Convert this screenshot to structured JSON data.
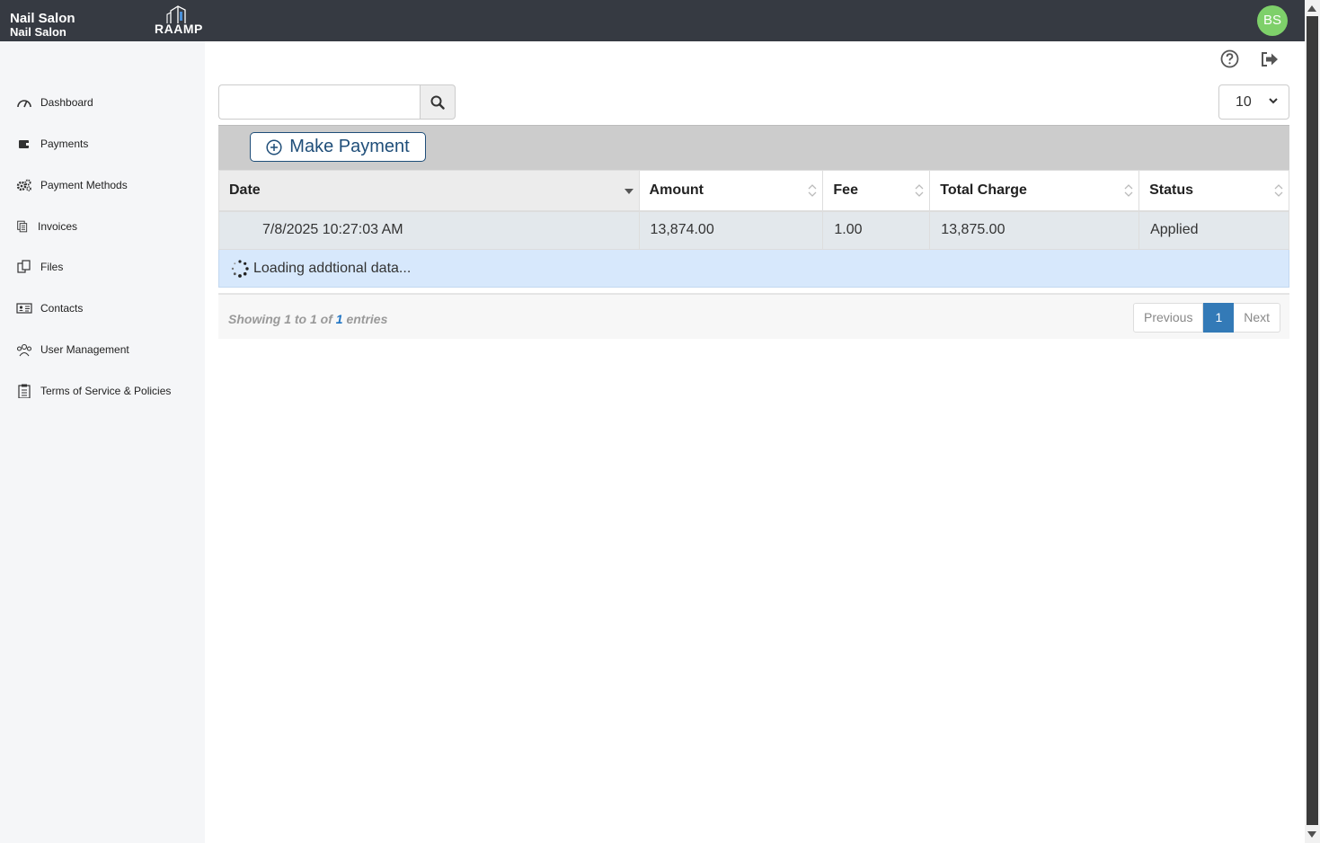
{
  "header": {
    "brand_line1": "Nail Salon",
    "brand_line2": "Nail Salon",
    "logo_text": "RAAMP",
    "avatar_initials": "BS",
    "avatar_color": "#7ed06a"
  },
  "sidebar": {
    "items": [
      {
        "label": "Dashboard",
        "icon": "speedometer-icon"
      },
      {
        "label": "Payments",
        "icon": "wallet-icon"
      },
      {
        "label": "Payment Methods",
        "icon": "gears-icon"
      },
      {
        "label": "Invoices",
        "icon": "invoice-icon"
      },
      {
        "label": "Files",
        "icon": "files-icon"
      },
      {
        "label": "Contacts",
        "icon": "contact-card-icon"
      },
      {
        "label": "User Management",
        "icon": "users-icon"
      },
      {
        "label": "Terms of Service & Policies",
        "icon": "clipboard-icon"
      }
    ]
  },
  "toolbar": {
    "search_value": "",
    "page_size": "10",
    "make_payment_label": "Make Payment"
  },
  "table": {
    "columns": [
      "Date",
      "Amount",
      "Fee",
      "Total Charge",
      "Status"
    ],
    "sorted_column": "Date",
    "rows": [
      {
        "date": "7/8/2025 10:27:03 AM",
        "amount": "13,874.00",
        "fee": "1.00",
        "total": "13,875.00",
        "status": "Applied"
      }
    ],
    "loading_text": "Loading addtional data..."
  },
  "footer": {
    "info_prefix": "Showing 1 to 1 of ",
    "info_total": "1",
    "info_suffix": " entries",
    "prev_label": "Previous",
    "current_page": "1",
    "next_label": "Next"
  },
  "colors": {
    "topbar": "#363a42",
    "accent": "#337ab7",
    "button_border": "#1f4e79"
  }
}
